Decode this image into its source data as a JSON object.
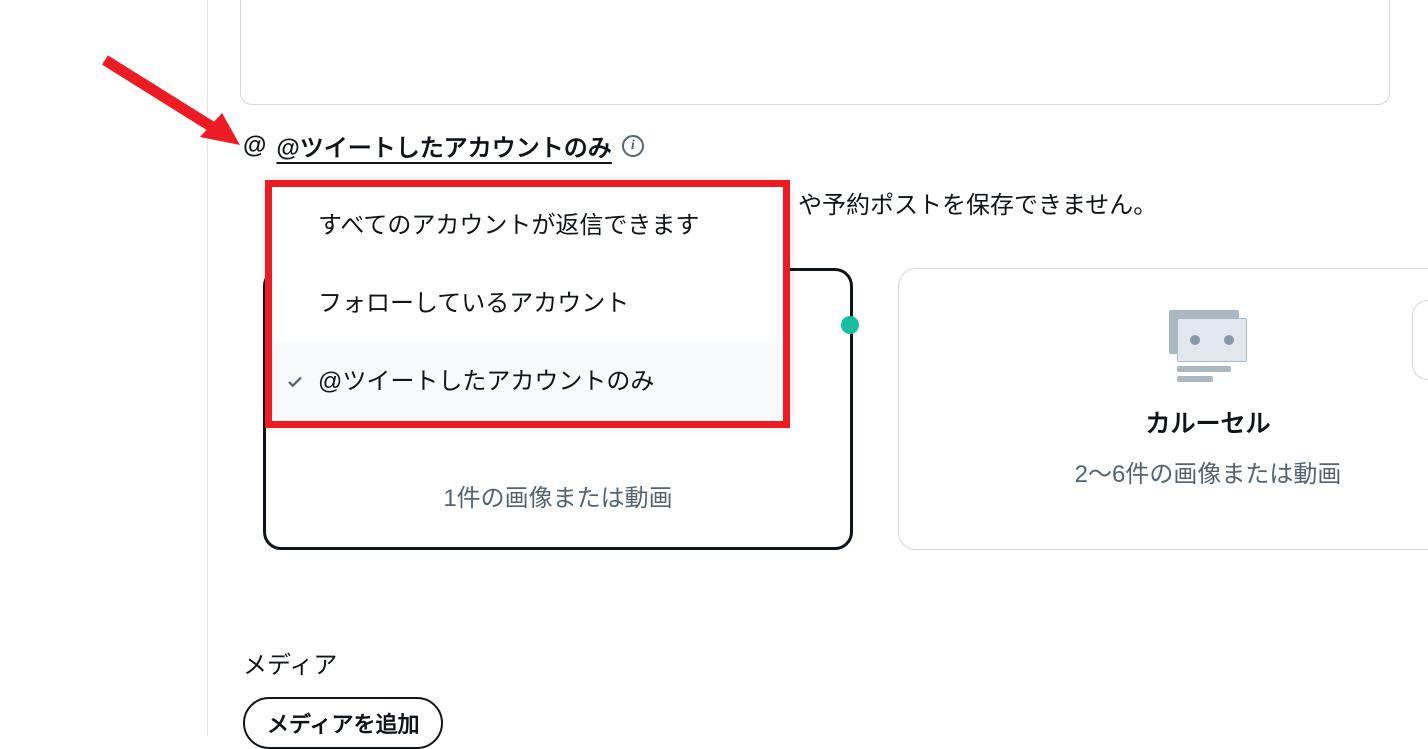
{
  "reply_setting": {
    "icon": "@",
    "selected_label": "@ツイートしたアカウントのみ",
    "info": "i"
  },
  "warning_suffix": "や予約ポストを保存できません。",
  "dropdown_options": [
    {
      "label": "すべてのアカウントが返信できます",
      "selected": false
    },
    {
      "label": "フォローしているアカウント",
      "selected": false
    },
    {
      "label": "@ツイートしたアカウントのみ",
      "selected": true
    }
  ],
  "card_single": {
    "subtitle": "1件の画像または動画"
  },
  "card_carousel": {
    "title": "カルーセル",
    "subtitle": "2～6件の画像または動画"
  },
  "media_section": {
    "label": "メディア",
    "add_button": "メディアを追加"
  }
}
